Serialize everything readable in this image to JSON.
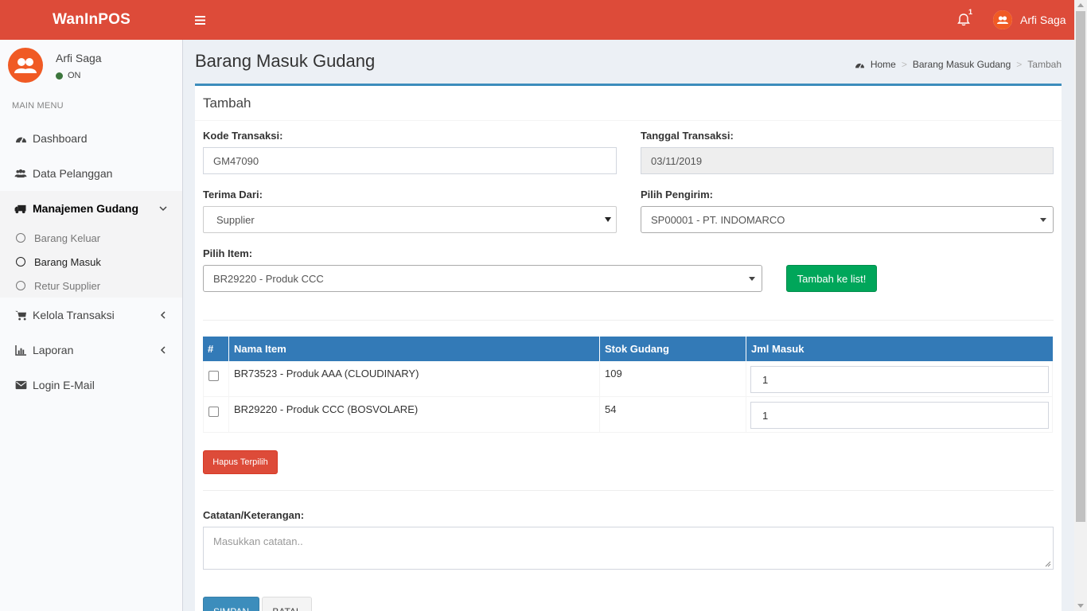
{
  "header": {
    "brand": "WanInPOS",
    "notification_count": "1",
    "user_name": "Arfi Saga",
    "bg_color": "#dd4b39"
  },
  "sidebar": {
    "user_name": "Arfi Saga",
    "status": "ON",
    "menu_header": "MAIN MENU",
    "items": [
      {
        "label": "Dashboard",
        "icon": "dashboard-icon"
      },
      {
        "label": "Data Pelanggan",
        "icon": "users-icon"
      },
      {
        "label": "Manajemen Gudang",
        "icon": "truck-icon"
      },
      {
        "label": "Kelola Transaksi",
        "icon": "cart-icon"
      },
      {
        "label": "Laporan",
        "icon": "bar-chart-icon"
      },
      {
        "label": "Login E-Mail",
        "icon": "envelope-icon"
      }
    ],
    "submenu": [
      {
        "label": "Barang Keluar"
      },
      {
        "label": "Barang Masuk"
      },
      {
        "label": "Retur Supplier"
      }
    ]
  },
  "page": {
    "title": "Barang Masuk Gudang",
    "breadcrumb": [
      "Home",
      "Barang Masuk Gudang",
      "Tambah"
    ]
  },
  "form": {
    "box_title": "Tambah",
    "kode_label": "Kode Transaksi:",
    "kode_value": "GM47090",
    "tanggal_label": "Tanggal Transaksi:",
    "tanggal_value": "03/11/2019",
    "terima_label": "Terima Dari:",
    "terima_value": "Supplier",
    "pengirim_label": "Pilih Pengirim:",
    "pengirim_value": "SP00001 - PT. INDOMARCO",
    "item_label": "Pilih Item:",
    "item_value": "BR29220 - Produk CCC",
    "add_button": "Tambah ke list!",
    "delete_button": "Hapus Terpilih",
    "notes_label": "Catatan/Keterangan:",
    "notes_placeholder": "Masukkan catatan..",
    "save_button": "SIMPAN",
    "cancel_button": "BATAL"
  },
  "table": {
    "headers": [
      "#",
      "Nama Item",
      "Stok Gudang",
      "Jml Masuk"
    ],
    "rows": [
      {
        "name": "BR73523 - Produk AAA (CLOUDINARY)",
        "stock": "109",
        "qty": "1"
      },
      {
        "name": "BR29220 - Produk CCC (BOSVOLARE)",
        "stock": "54",
        "qty": "1"
      }
    ],
    "header_color": "#337ab7"
  }
}
